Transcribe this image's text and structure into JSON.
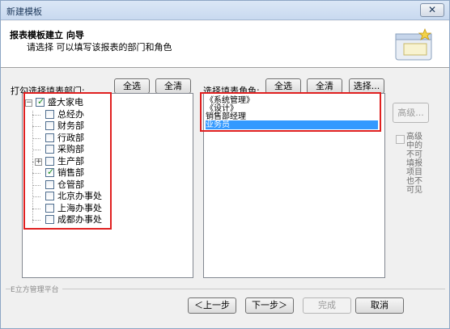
{
  "window": {
    "title": "新建模板",
    "close_symbol": "✕"
  },
  "header": {
    "title": "报表模板建立 向导",
    "subtitle": "请选择 可以填写该报表的部门和角色",
    "icon": "wizard-icon"
  },
  "departments": {
    "label": "打勾选择填表部门:",
    "select_all": "全选",
    "clear_all": "全清",
    "tree": [
      {
        "label": "盛大家电",
        "level": 0,
        "checked": true,
        "expandable": true,
        "expanded": true
      },
      {
        "label": "总经办",
        "level": 1,
        "checked": false
      },
      {
        "label": "财务部",
        "level": 1,
        "checked": false
      },
      {
        "label": "行政部",
        "level": 1,
        "checked": false
      },
      {
        "label": "采购部",
        "level": 1,
        "checked": false
      },
      {
        "label": "生产部",
        "level": 1,
        "checked": false,
        "expandable": true,
        "expanded": false
      },
      {
        "label": "销售部",
        "level": 1,
        "checked": true
      },
      {
        "label": "仓管部",
        "level": 1,
        "checked": false
      },
      {
        "label": "北京办事处",
        "level": 1,
        "checked": false
      },
      {
        "label": "上海办事处",
        "level": 1,
        "checked": false
      },
      {
        "label": "成都办事处",
        "level": 1,
        "checked": false
      }
    ]
  },
  "roles": {
    "label": "选择填表角色:",
    "select_all": "全选",
    "clear_all": "全清",
    "choose": "选择...",
    "items": [
      {
        "label": "《系统管理》",
        "selected": false
      },
      {
        "label": "《设计》",
        "selected": false
      },
      {
        "label": "销售部经理",
        "selected": false
      },
      {
        "label": "业务员",
        "selected": true
      }
    ]
  },
  "advanced": {
    "button": "高级...",
    "checkbox_text": "高级中的不可填报项目也不可见"
  },
  "footer": {
    "brand": "E立方管理平台",
    "prev": "＜上一步",
    "next": "下一步＞",
    "finish": "完成",
    "cancel": "取消"
  },
  "colors": {
    "highlight": "#e02020",
    "selection": "#3399ff",
    "check": "#1b8f1b"
  }
}
